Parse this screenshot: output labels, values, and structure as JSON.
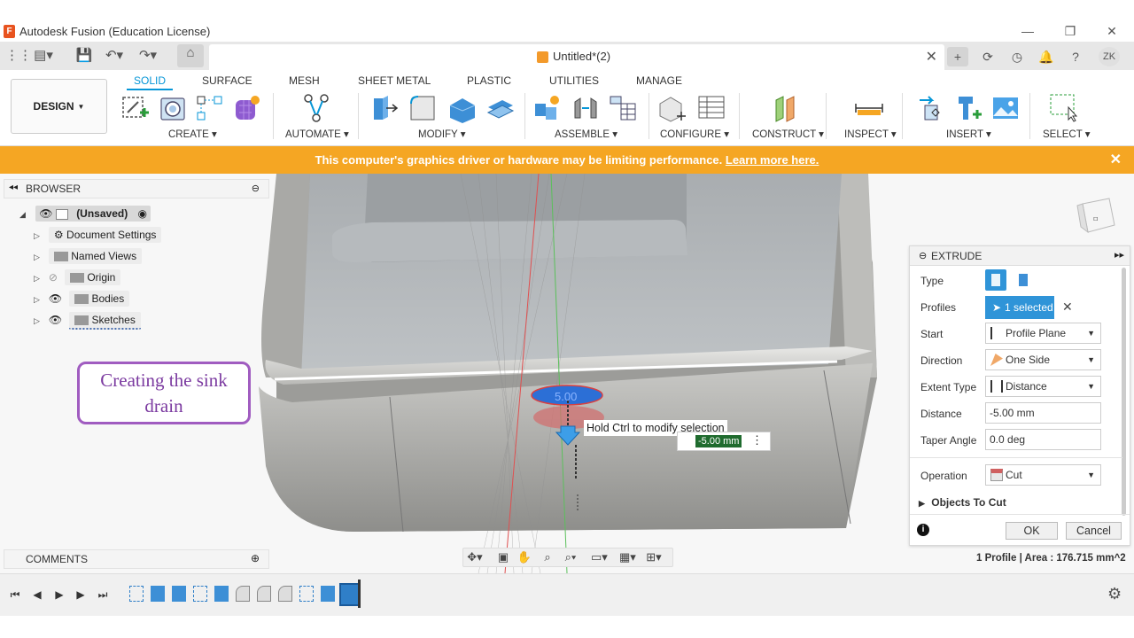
{
  "window": {
    "title": "Autodesk Fusion (Education License)"
  },
  "document": {
    "tab_name": "Untitled*(2)",
    "user_initials": "ZK"
  },
  "ribbon": {
    "design_label": "DESIGN",
    "tabs": [
      "SOLID",
      "SURFACE",
      "MESH",
      "SHEET METAL",
      "PLASTIC",
      "UTILITIES",
      "MANAGE"
    ],
    "groups": [
      "CREATE",
      "AUTOMATE",
      "MODIFY",
      "ASSEMBLE",
      "CONFIGURE",
      "CONSTRUCT",
      "INSPECT",
      "INSERT",
      "SELECT"
    ]
  },
  "banner": {
    "text": "This computer's graphics driver or hardware may be limiting performance.",
    "link": "Learn more here."
  },
  "browser": {
    "title": "BROWSER",
    "root": "(Unsaved)",
    "items": [
      "Document Settings",
      "Named Views",
      "Origin",
      "Bodies",
      "Sketches"
    ]
  },
  "comments": {
    "title": "COMMENTS"
  },
  "callout": {
    "line1": "Creating the sink",
    "line2": "drain"
  },
  "canvas": {
    "tooltip": "Hold Ctrl to modify selection",
    "distance_input": "-5.00 mm",
    "profile_label": "5.00"
  },
  "extrude": {
    "title": "EXTRUDE",
    "labels": {
      "type": "Type",
      "profiles": "Profiles",
      "start": "Start",
      "direction": "Direction",
      "extent_type": "Extent Type",
      "distance": "Distance",
      "taper_angle": "Taper Angle",
      "operation": "Operation",
      "objects_to_cut": "Objects To Cut"
    },
    "profiles_value": "1 selected",
    "start_value": "Profile Plane",
    "direction_value": "One Side",
    "extent_value": "Distance",
    "distance_value": "-5.00 mm",
    "taper_value": "0.0 deg",
    "operation_value": "Cut",
    "ok": "OK",
    "cancel": "Cancel"
  },
  "status": {
    "profile_info": "1 Profile | Area : 176.715 mm^2"
  },
  "colors": {
    "accent": "#0696d7",
    "banner": "#f5a623",
    "callout": "#a05cc0"
  }
}
